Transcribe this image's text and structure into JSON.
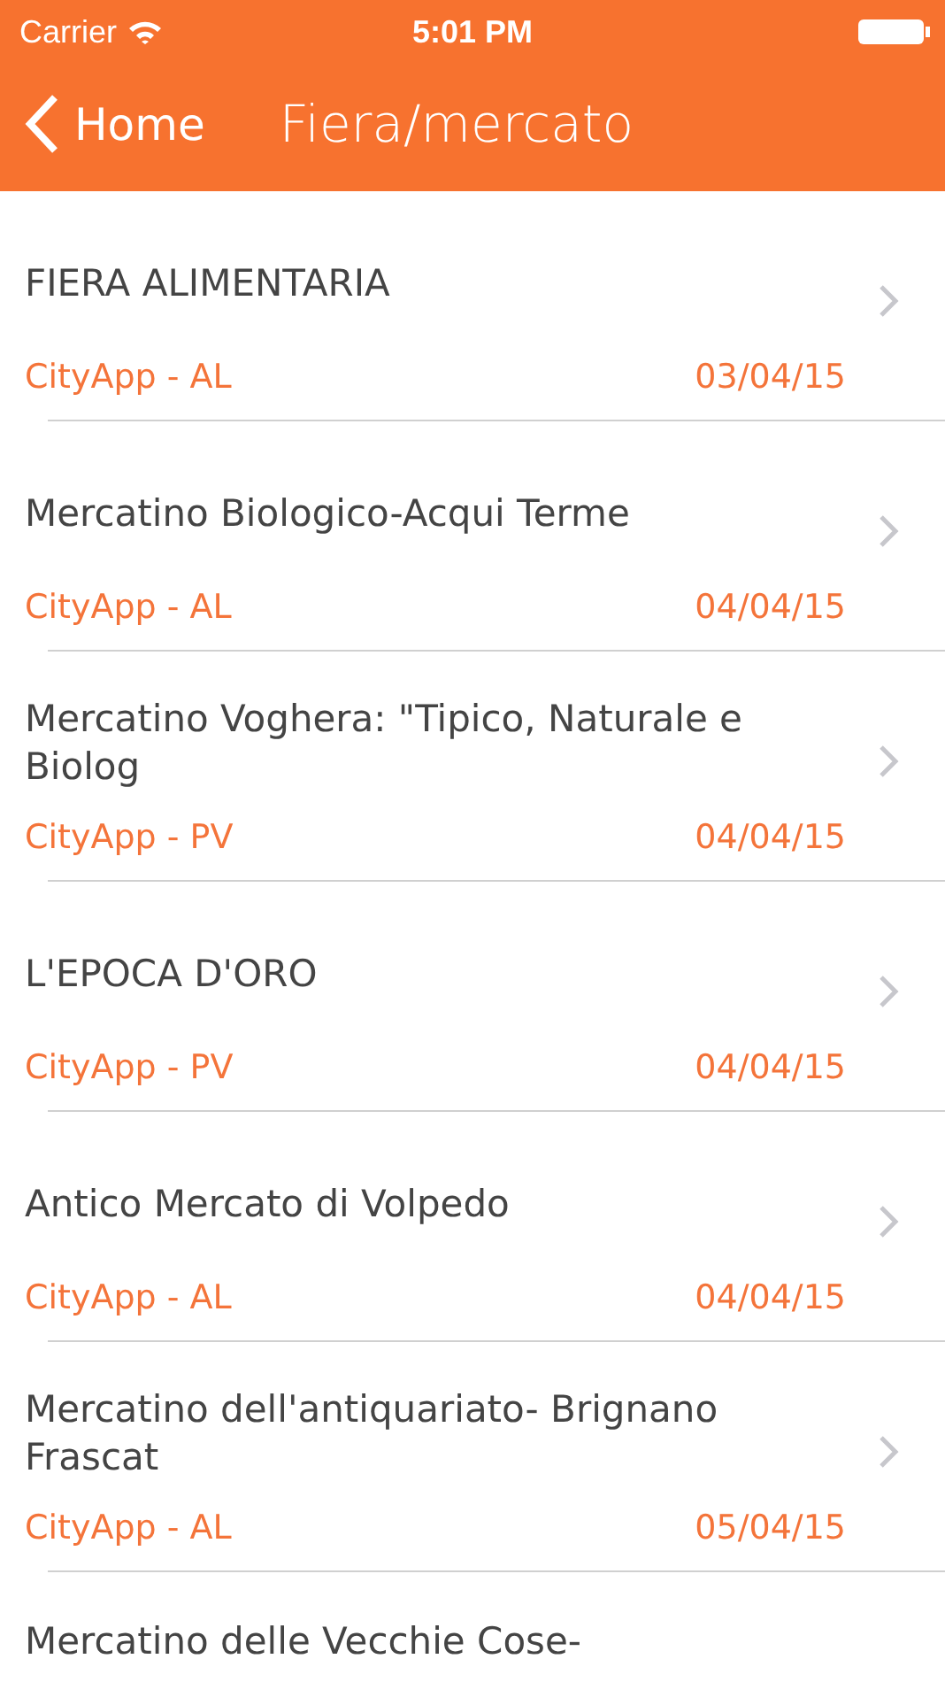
{
  "status_bar": {
    "carrier": "Carrier",
    "time": "5:01 PM"
  },
  "nav": {
    "back": "Home",
    "title": "Fiera/mercato"
  },
  "events": [
    {
      "kind": "full",
      "title": "FIERA ALIMENTARIA",
      "source": "CityApp - AL",
      "date": "03/04/15"
    },
    {
      "kind": "full",
      "title": "Mercatino Biologico-Acqui Terme",
      "source": "CityApp - AL",
      "date": "04/04/15"
    },
    {
      "kind": "full",
      "title": "Mercatino Voghera: \"Tipico, Naturale e Biolog",
      "source": "CityApp - PV",
      "date": "04/04/15"
    },
    {
      "kind": "full",
      "title": "L'EPOCA D'ORO",
      "source": "CityApp - PV",
      "date": "04/04/15"
    },
    {
      "kind": "full",
      "title": "Antico Mercato di Volpedo",
      "source": "CityApp - AL",
      "date": "04/04/15"
    },
    {
      "kind": "full",
      "title": "Mercatino dell'antiquariato- Brignano Frascat",
      "source": "CityApp - AL",
      "date": "05/04/15"
    },
    {
      "kind": "partial",
      "title": "Mercatino delle Vecchie Cose-"
    }
  ]
}
